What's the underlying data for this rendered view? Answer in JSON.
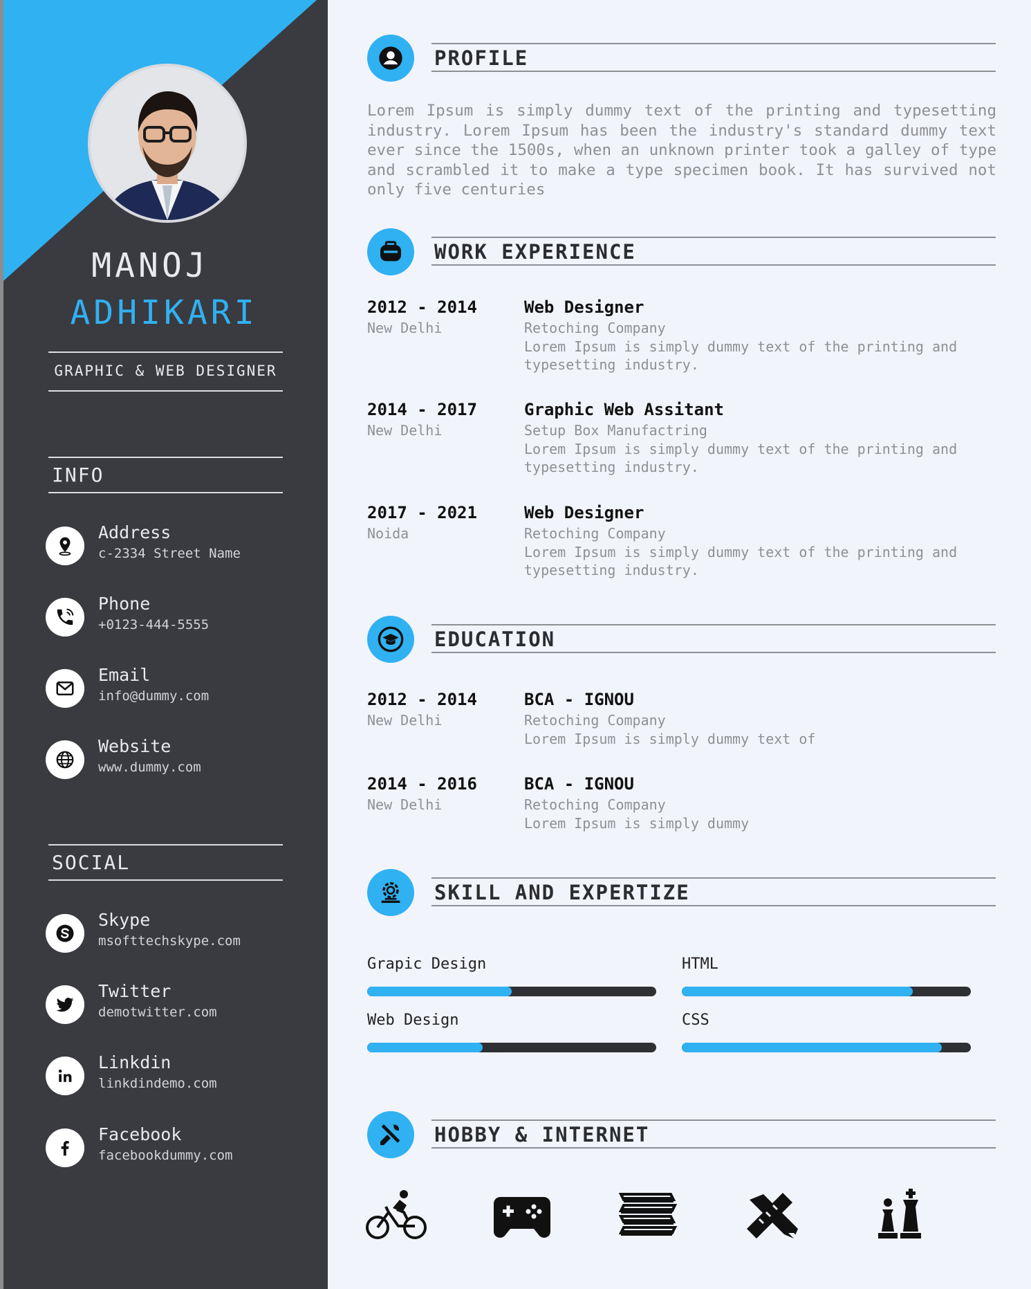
{
  "sidebar": {
    "name_first": "MANOJ",
    "name_last": "ADHIKARI",
    "role": "GRAPHIC & WEB DESIGNER",
    "info_heading": "INFO",
    "info": [
      {
        "label": "Address",
        "value": "c-2334 Street Name",
        "icon": "location-pin-icon"
      },
      {
        "label": "Phone",
        "value": "+0123-444-5555",
        "icon": "phone-icon"
      },
      {
        "label": "Email",
        "value": "info@dummy.com",
        "icon": "mail-icon"
      },
      {
        "label": "Website",
        "value": "www.dummy.com",
        "icon": "globe-icon"
      }
    ],
    "social_heading": "SOCIAL",
    "social": [
      {
        "label": "Skype",
        "value": "msofttechskype.com",
        "icon": "skype-icon"
      },
      {
        "label": "Twitter",
        "value": "demotwitter.com",
        "icon": "twitter-icon"
      },
      {
        "label": "Linkdin",
        "value": "linkdindemo.com",
        "icon": "linkedin-icon"
      },
      {
        "label": "Facebook",
        "value": "facebookdummy.com",
        "icon": "facebook-icon"
      }
    ]
  },
  "profile": {
    "title": "PROFILE",
    "text": "Lorem Ipsum is simply dummy text of the printing and typesetting industry. Lorem Ipsum has been the industry's standard dummy text ever since the 1500s, when an unknown printer took a galley of type and scrambled it to make a type specimen book. It has survived not only five centuries"
  },
  "work": {
    "title": "WORK EXPERIENCE",
    "items": [
      {
        "years": "2012 - 2014",
        "place": "New Delhi",
        "title": "Web Designer",
        "company": "Retoching Company",
        "desc": "Lorem Ipsum is simply dummy text of the printing and typesetting industry."
      },
      {
        "years": "2014 - 2017",
        "place": "New Delhi",
        "title": "Graphic Web Assitant",
        "company": "Setup Box Manufactring",
        "desc": "Lorem Ipsum is simply dummy text of the printing and typesetting industry."
      },
      {
        "years": "2017 - 2021",
        "place": "Noida",
        "title": "Web Designer",
        "company": "Retoching Company",
        "desc": "Lorem Ipsum is simply dummy text of the printing and typesetting industry."
      }
    ]
  },
  "education": {
    "title": "EDUCATION",
    "items": [
      {
        "years": "2012 - 2014",
        "place": "New Delhi",
        "title": "BCA - IGNOU",
        "company": "Retoching Company",
        "desc": "Lorem Ipsum is simply dummy text of"
      },
      {
        "years": "2014 - 2016",
        "place": "New Delhi",
        "title": "BCA - IGNOU",
        "company": "Retoching Company",
        "desc": "Lorem Ipsum is simply dummy"
      }
    ]
  },
  "skills": {
    "title": "SKILL AND EXPERTIZE",
    "items": [
      {
        "name": "Grapic Design",
        "level": 0.5
      },
      {
        "name": "HTML",
        "level": 0.8
      },
      {
        "name": "Web Design",
        "level": 0.4
      },
      {
        "name": "CSS",
        "level": 0.9
      }
    ]
  },
  "hobby": {
    "title": "HOBBY & INTERNET",
    "icons": [
      "cycling-icon",
      "gamepad-icon",
      "books-icon",
      "drawing-tools-icon",
      "chess-icon"
    ]
  },
  "colors": {
    "accent": "#30b1f2",
    "sidebar": "#3a3b40",
    "page": "#f2f4fc"
  }
}
